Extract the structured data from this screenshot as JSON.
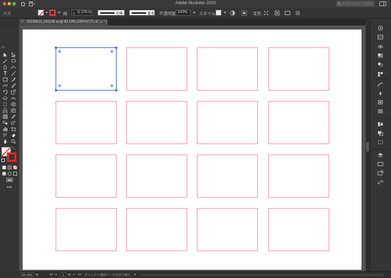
{
  "window": {
    "title": "Adobe Illustrator 2019",
    "search_placeholder": "Adobe Stock を検索"
  },
  "control_bar": {
    "selection_label": "パス",
    "stroke_label": "線",
    "stroke_weight": "0.176 m",
    "variable_width": "均等",
    "brush": "基本",
    "opacity_label": "不透明度",
    "opacity": "100%",
    "style_label": "スタイル",
    "transform_label": "変形"
  },
  "document": {
    "tab_title": "20190612_041139.ai @ 92.19% (CMYK/プレビュー)"
  },
  "artboard_grid": {
    "rows": 4,
    "columns": 4,
    "selected_index": 0
  },
  "status_bar": {
    "zoom": "92.19%",
    "page": "1",
    "nav_first": "◂◂",
    "nav_prev": "◂",
    "nav_next": "▸",
    "nav_last": "▸▸",
    "tool_hint": "ダイレクト選択ツールを切り替え",
    "arrow": "▸"
  },
  "colors": {
    "artboard_border": "#f0a0b4",
    "selection": "#4a6fd8",
    "stroke_red": "#e02525",
    "canvas": "#535353",
    "ui_dark": "#353535"
  },
  "icons": {
    "tools": [
      "selection-tool",
      "direct-selection-tool",
      "magic-wand-tool",
      "lasso-tool",
      "pen-tool",
      "curvature-tool",
      "type-tool",
      "line-tool",
      "rectangle-tool",
      "paintbrush-tool",
      "shaper-tool",
      "pencil-tool",
      "rotate-tool",
      "scale-tool",
      "width-tool",
      "warp-tool",
      "free-transform-tool",
      "shape-builder-tool",
      "perspective-grid-tool",
      "mesh-tool",
      "gradient-tool",
      "eyedropper-tool",
      "blend-tool",
      "symbol-sprayer-tool",
      "column-graph-tool",
      "artboard-tool",
      "slice-tool",
      "eraser-tool",
      "hand-tool",
      "zoom-tool"
    ],
    "dock": [
      "properties-icon",
      "libraries-icon",
      "cc-libraries-icon",
      "transparency-icon",
      "color-guide-icon",
      "swatches-icon",
      "brushes-icon",
      "symbols-icon",
      "graphic-styles-icon",
      "appearance-icon",
      "align-icon",
      "pathfinder-icon",
      "transform-icon",
      "layers-icon",
      "artboards-icon",
      "asset-export-icon",
      "links-icon"
    ]
  }
}
